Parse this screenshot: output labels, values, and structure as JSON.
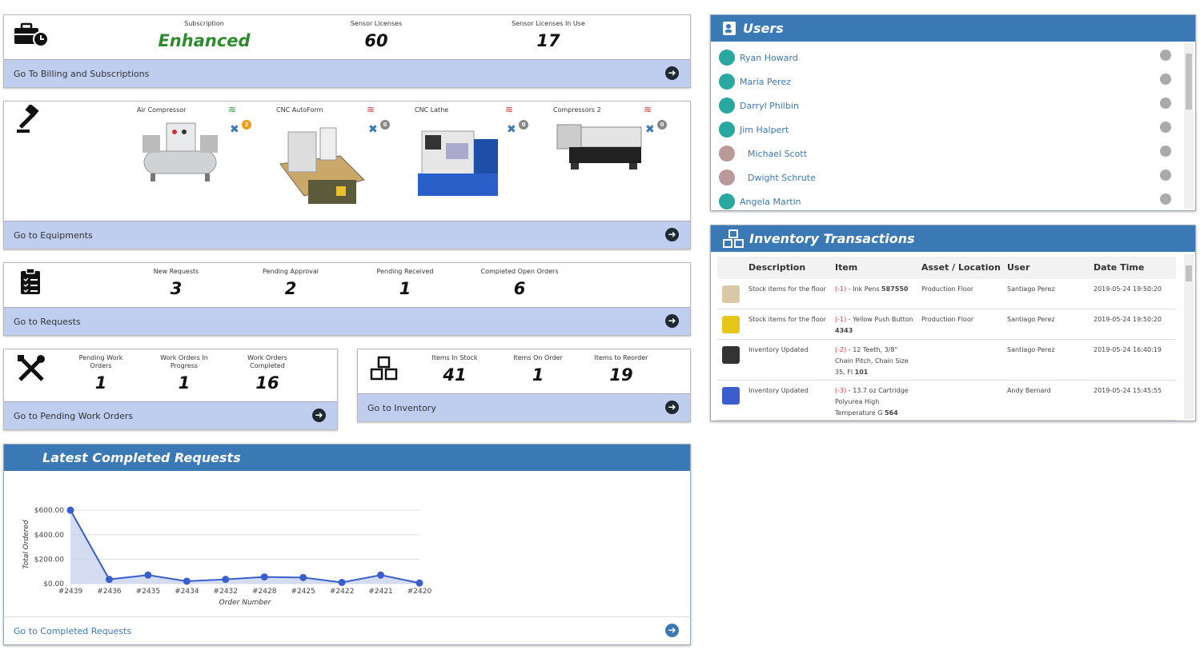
{
  "subscription": {
    "stats": [
      {
        "label": "Subscription",
        "value": "Enhanced"
      },
      {
        "label": "Sensor Licenses",
        "value": "60"
      },
      {
        "label": "Sensor Licenses In Use",
        "value": "17"
      }
    ],
    "link": "Go To Billing and Subscriptions"
  },
  "equipment": {
    "items": [
      {
        "name": "Air Compressor",
        "badge": "2",
        "badge_color": "#f39c12",
        "wifi": "on"
      },
      {
        "name": "CNC AutoForm",
        "badge": "0",
        "badge_color": "#888",
        "wifi": "off"
      },
      {
        "name": "CNC Lathe",
        "badge": "0",
        "badge_color": "#888",
        "wifi": "off"
      },
      {
        "name": "Compressors 2",
        "badge": "0",
        "badge_color": "#888",
        "wifi": "off"
      }
    ],
    "link": "Go to Equipments"
  },
  "requests": {
    "stats": [
      {
        "label": "New Requests",
        "value": "3"
      },
      {
        "label": "Pending Approval",
        "value": "2"
      },
      {
        "label": "Pending Received",
        "value": "1"
      },
      {
        "label": "Completed Open Orders",
        "value": "6"
      }
    ],
    "link": "Go to Requests"
  },
  "workorders": {
    "stats": [
      {
        "label": "Pending Work Orders",
        "value": "1"
      },
      {
        "label": "Work Orders In Progress",
        "value": "1"
      },
      {
        "label": "Work Orders Completed",
        "value": "16"
      }
    ],
    "link": "Go to Pending Work Orders"
  },
  "inventory_summary": {
    "stats": [
      {
        "label": "Items In Stock",
        "value": "41"
      },
      {
        "label": "Items On Order",
        "value": "1"
      },
      {
        "label": "Items to Reorder",
        "value": "19"
      }
    ],
    "link": "Go to Inventory"
  },
  "latest_completed": {
    "title": "Latest Completed Requests",
    "link": "Go to Completed Requests"
  },
  "chart_data": {
    "type": "area",
    "title": "Latest Completed Requests",
    "xlabel": "Order Number",
    "ylabel": "Total Ordered",
    "categories": [
      "#2439",
      "#2436",
      "#2435",
      "#2434",
      "#2432",
      "#2428",
      "#2425",
      "#2422",
      "#2421",
      "#2420"
    ],
    "values": [
      600,
      35,
      70,
      20,
      35,
      55,
      50,
      10,
      70,
      5
    ],
    "yticks": [
      "$0.00",
      "$200.00",
      "$400.00",
      "$600.00"
    ],
    "ylim": [
      0,
      640
    ],
    "grid": true,
    "color": "#3a5fcd"
  },
  "users": {
    "title": "Users",
    "list": [
      {
        "name": "Ryan Howard",
        "avatar": "default"
      },
      {
        "name": "Maria Perez",
        "avatar": "default"
      },
      {
        "name": "Darryl Philbin",
        "avatar": "default"
      },
      {
        "name": "Jim Halpert",
        "avatar": "default"
      },
      {
        "name": "Michael Scott",
        "avatar": "photo"
      },
      {
        "name": "Dwight Schrute",
        "avatar": "photo"
      },
      {
        "name": "Angela Martin",
        "avatar": "default"
      }
    ]
  },
  "inventory_transactions": {
    "title": "Inventory Transactions",
    "headers": [
      "Description",
      "Item",
      "Asset / Location",
      "User",
      "Date Time"
    ],
    "rows": [
      {
        "desc": "Stock items for the floor",
        "qty": "(-1)",
        "item": " - Ink Pens ",
        "code": "587550",
        "location": "Production Floor",
        "user": "Santiago Perez",
        "date": "2019-05-24 19:50:20"
      },
      {
        "desc": "Stock items for the floor",
        "qty": "(-1)",
        "item": " - Yellow Push Button ",
        "code": "4343",
        "location": "Production Floor",
        "user": "Santiago Perez",
        "date": "2019-05-24 19:50:20"
      },
      {
        "desc": "Inventory Updated",
        "qty": "(-2)",
        "item": " - 12 Teeth, 3/8\" Chain Pitch, Chain Size 35, Fl ",
        "code": "101",
        "location": "",
        "user": "Santiago Perez",
        "date": "2019-05-24 16:40:19"
      },
      {
        "desc": "Inventory Updated",
        "qty": "(-3)",
        "item": " - 13.7 oz Cartridge Polyurea High Temperature G ",
        "code": "564",
        "location": "",
        "user": "Andy Bernard",
        "date": "2019-05-24 15:45:55"
      }
    ]
  }
}
